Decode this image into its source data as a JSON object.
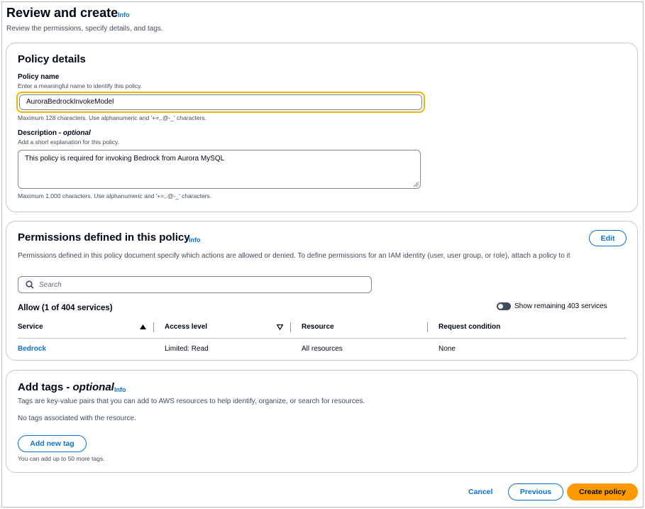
{
  "page": {
    "title": "Review and create",
    "info": "Info",
    "subtitle": "Review the permissions, specify details, and tags."
  },
  "policy_details": {
    "heading": "Policy details",
    "name_label": "Policy name",
    "name_hint": "Enter a meaningful name to identify this policy.",
    "name_value": "AuroraBedrockInvokeModel",
    "name_constraint": "Maximum 128 characters. Use alphanumeric and '+=,.@-_' characters.",
    "description_label": "Description - ",
    "description_optional": "optional",
    "description_hint": "Add a short explanation for this policy.",
    "description_value": "This policy is required for invoking Bedrock from Aurora MySQL",
    "description_constraint": "Maximum 1,000 characters. Use alphanumeric and '+=,.@-_' characters."
  },
  "permissions": {
    "heading": "Permissions defined in this policy",
    "info": "Info",
    "edit_label": "Edit",
    "description": "Permissions defined in this policy document specify which actions are allowed or denied. To define permissions for an IAM identity (user, user group, or role), attach a policy to it",
    "search_placeholder": "Search",
    "allow_label": "Allow (1 of 404 services)",
    "toggle_label": "Show remaining 403 services",
    "columns": [
      "Service",
      "Access level",
      "Resource",
      "Request condition"
    ],
    "rows": [
      {
        "service": "Bedrock",
        "access_level": "Limited: Read",
        "resource": "All resources",
        "condition": "None"
      }
    ]
  },
  "tags": {
    "heading": "Add tags - ",
    "heading_optional": "optional",
    "info": "Info",
    "description": "Tags are key-value pairs that you can add to AWS resources to help identify, organize, or search for resources.",
    "empty_text": "No tags associated with the resource.",
    "add_button": "Add new tag",
    "limit_text": "You can add up to 50 more tags."
  },
  "footer": {
    "cancel": "Cancel",
    "previous": "Previous",
    "create": "Create policy"
  }
}
